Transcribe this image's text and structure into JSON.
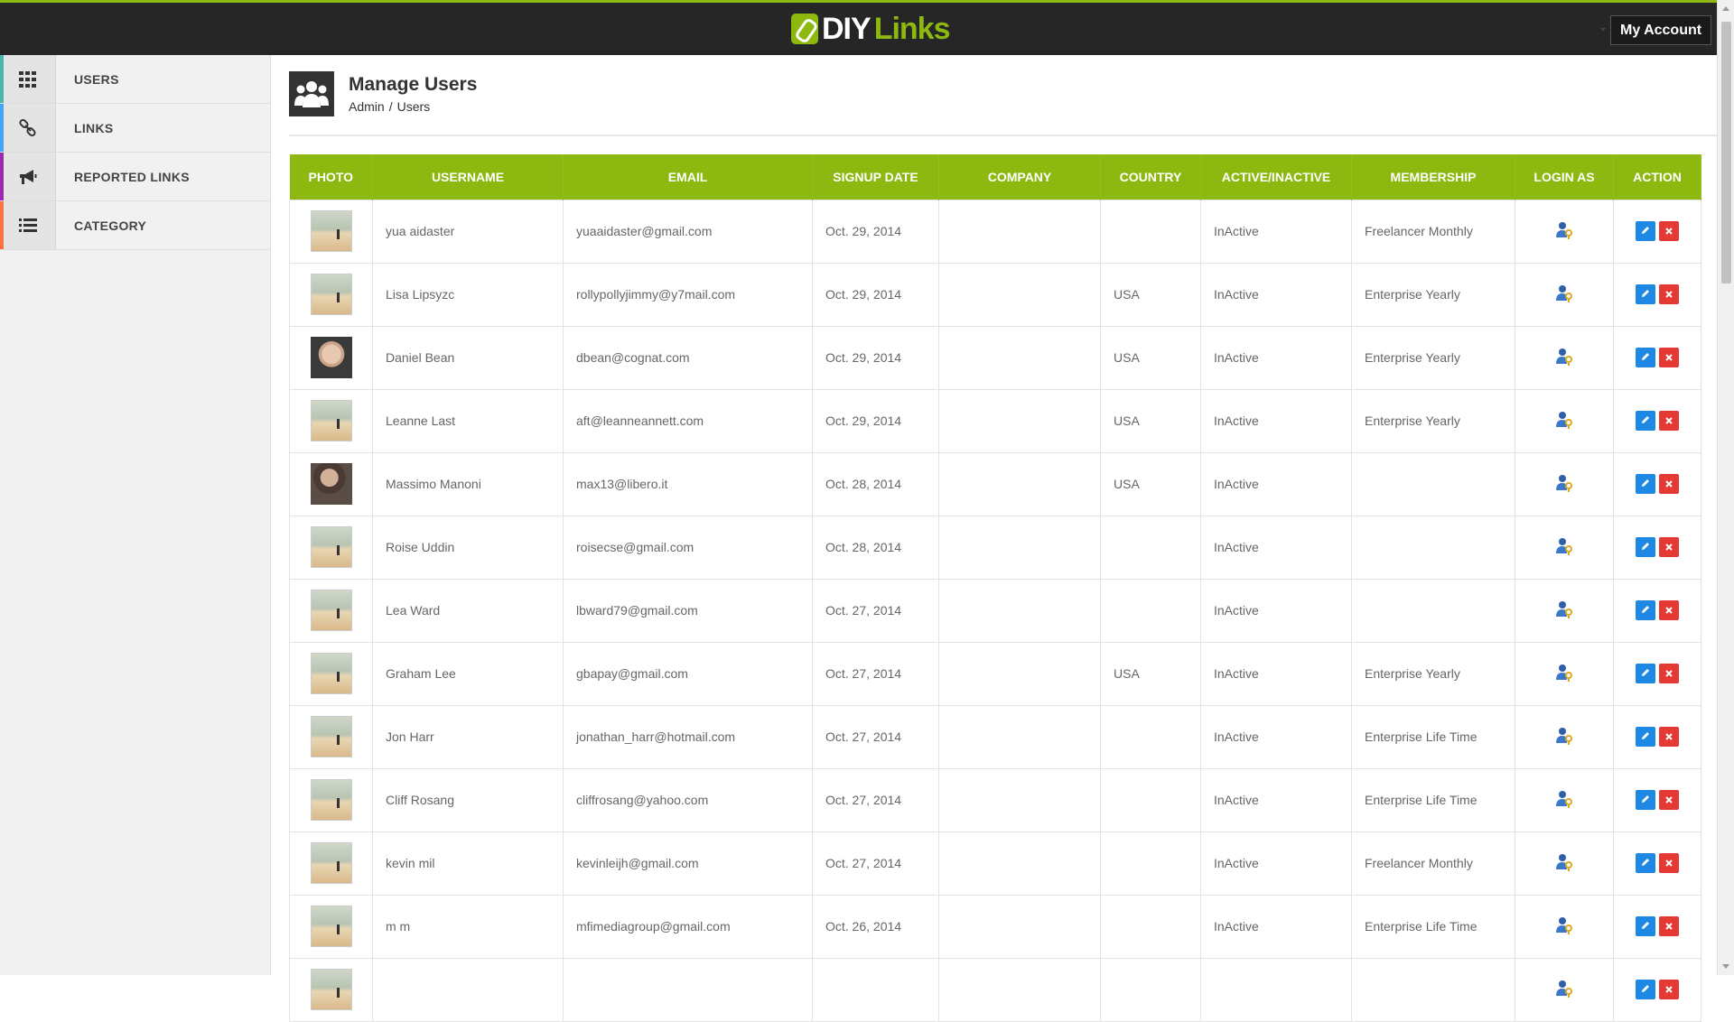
{
  "brand": {
    "part1": "DIY",
    "part2": "Links"
  },
  "header": {
    "account_label": "My Account"
  },
  "sidebar": {
    "items": [
      {
        "label": "USERS",
        "icon": "grid-icon",
        "stripe": "#4db6ac"
      },
      {
        "label": "LINKS",
        "icon": "link-icon",
        "stripe": "#42a5f5"
      },
      {
        "label": "REPORTED LINKS",
        "icon": "megaphone-icon",
        "stripe": "#9c27b0"
      },
      {
        "label": "CATEGORY",
        "icon": "list-icon",
        "stripe": "#ff7043"
      }
    ]
  },
  "page": {
    "title": "Manage Users",
    "breadcrumb": [
      "Admin",
      "Users"
    ],
    "breadcrumb_sep": "/"
  },
  "table": {
    "columns": [
      "PHOTO",
      "USERNAME",
      "EMAIL",
      "SIGNUP DATE",
      "COMPANY",
      "COUNTRY",
      "ACTIVE/INACTIVE",
      "MEMBERSHIP",
      "LOGIN AS",
      "ACTION"
    ],
    "rows": [
      {
        "photo": "beach",
        "username": "yua aidaster",
        "email": "yuaaidaster@gmail.com",
        "signup": "Oct. 29, 2014",
        "company": "",
        "country": "",
        "status": "InActive",
        "membership": "Freelancer Monthly"
      },
      {
        "photo": "beach",
        "username": "Lisa Lipsyzc",
        "email": "rollypollyjimmy@y7mail.com",
        "signup": "Oct. 29, 2014",
        "company": "",
        "country": "USA",
        "status": "InActive",
        "membership": "Enterprise Yearly"
      },
      {
        "photo": "person1",
        "username": "Daniel Bean",
        "email": "dbean@cognat.com",
        "signup": "Oct. 29, 2014",
        "company": "",
        "country": "USA",
        "status": "InActive",
        "membership": "Enterprise Yearly"
      },
      {
        "photo": "beach",
        "username": "Leanne Last",
        "email": "aft@leanneannett.com",
        "signup": "Oct. 29, 2014",
        "company": "",
        "country": "USA",
        "status": "InActive",
        "membership": "Enterprise Yearly"
      },
      {
        "photo": "person2",
        "username": "Massimo Manoni",
        "email": "max13@libero.it",
        "signup": "Oct. 28, 2014",
        "company": "",
        "country": "USA",
        "status": "InActive",
        "membership": ""
      },
      {
        "photo": "beach",
        "username": "Roise Uddin",
        "email": "roisecse@gmail.com",
        "signup": "Oct. 28, 2014",
        "company": "",
        "country": "",
        "status": "InActive",
        "membership": ""
      },
      {
        "photo": "beach",
        "username": "Lea Ward",
        "email": "lbward79@gmail.com",
        "signup": "Oct. 27, 2014",
        "company": "",
        "country": "",
        "status": "InActive",
        "membership": ""
      },
      {
        "photo": "beach",
        "username": "Graham Lee",
        "email": "gbapay@gmail.com",
        "signup": "Oct. 27, 2014",
        "company": "",
        "country": "USA",
        "status": "InActive",
        "membership": "Enterprise Yearly"
      },
      {
        "photo": "beach",
        "username": "Jon Harr",
        "email": "jonathan_harr@hotmail.com",
        "signup": "Oct. 27, 2014",
        "company": "",
        "country": "",
        "status": "InActive",
        "membership": "Enterprise Life Time"
      },
      {
        "photo": "beach",
        "username": "Cliff Rosang",
        "email": "cliffrosang@yahoo.com",
        "signup": "Oct. 27, 2014",
        "company": "",
        "country": "",
        "status": "InActive",
        "membership": "Enterprise Life Time"
      },
      {
        "photo": "beach",
        "username": "kevin mil",
        "email": "kevinleijh@gmail.com",
        "signup": "Oct. 27, 2014",
        "company": "",
        "country": "",
        "status": "InActive",
        "membership": "Freelancer Monthly"
      },
      {
        "photo": "beach",
        "username": "m m",
        "email": "mfimediagroup@gmail.com",
        "signup": "Oct. 26, 2014",
        "company": "",
        "country": "",
        "status": "InActive",
        "membership": "Enterprise Life Time"
      },
      {
        "photo": "beach",
        "username": "",
        "email": "",
        "signup": "",
        "company": "",
        "country": "",
        "status": "",
        "membership": ""
      }
    ]
  },
  "colors": {
    "accent": "#8cb80f",
    "topbar": "#262626",
    "edit": "#1e88e5",
    "delete": "#e53935"
  },
  "icons": {
    "login_as": "user-key-icon",
    "edit": "pencil-icon",
    "delete": "close-icon",
    "page": "users-group-icon"
  }
}
